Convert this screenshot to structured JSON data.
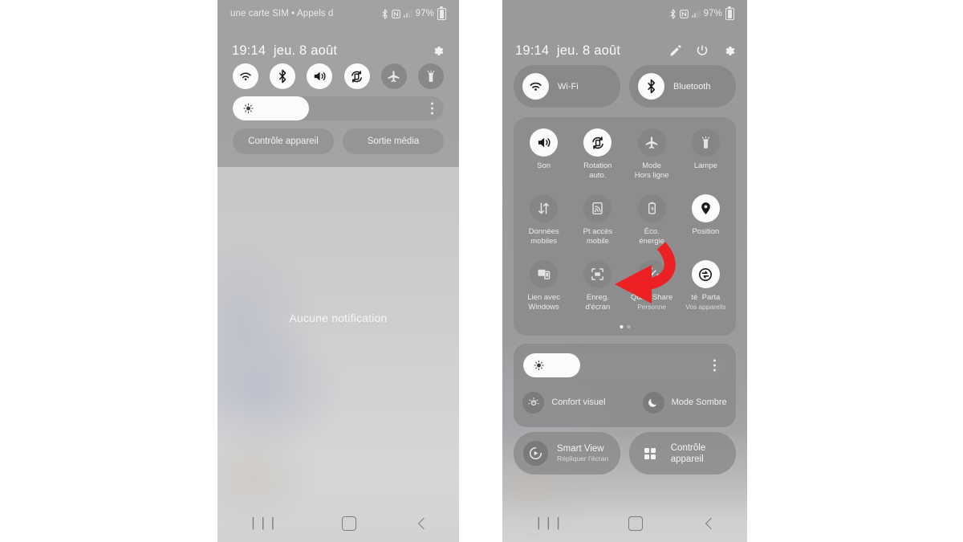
{
  "left_phone": {
    "status_bar": {
      "carrier_text": "une carte SIM • Appels d",
      "battery_percent": "97%",
      "icons": [
        "bluetooth-icon",
        "nfc-icon",
        "signal-icon",
        "battery-icon"
      ]
    },
    "clock": {
      "time": "19:14",
      "date": "jeu. 8 août"
    },
    "header_actions": [
      {
        "name": "settings-gear-button",
        "icon": "gear-icon"
      }
    ],
    "toggles": [
      {
        "name": "wifi",
        "icon": "wifi-icon",
        "state": "on"
      },
      {
        "name": "bluetooth",
        "icon": "bluetooth-icon",
        "state": "on"
      },
      {
        "name": "sound",
        "icon": "volume-icon",
        "state": "on"
      },
      {
        "name": "auto-rotate",
        "icon": "rotation-icon",
        "state": "on"
      },
      {
        "name": "airplane-mode",
        "icon": "airplane-icon",
        "state": "off"
      },
      {
        "name": "flashlight",
        "icon": "flashlight-icon",
        "state": "off"
      }
    ],
    "brightness": {
      "icon": "brightness-icon",
      "value_percent": 36,
      "menu_icon": "more-vertical-icon"
    },
    "wide_buttons": [
      {
        "name": "device-control",
        "label": "Contrôle appareil"
      },
      {
        "name": "media-output",
        "label": "Sortie média"
      }
    ],
    "notifications_empty_text": "Aucune notification",
    "nav_bar": [
      {
        "name": "recents",
        "icon": "recents-icon"
      },
      {
        "name": "home",
        "icon": "home-icon"
      },
      {
        "name": "back",
        "icon": "back-icon"
      }
    ]
  },
  "right_phone": {
    "status_bar": {
      "carrier_text": "",
      "battery_percent": "97%",
      "icons": [
        "bluetooth-icon",
        "nfc-icon",
        "signal-icon",
        "battery-icon"
      ]
    },
    "clock": {
      "time": "19:14",
      "date": "jeu. 8 août"
    },
    "header_actions": [
      {
        "name": "edit-button",
        "icon": "pencil-icon"
      },
      {
        "name": "power-button",
        "icon": "power-icon"
      },
      {
        "name": "settings-gear-button",
        "icon": "gear-icon"
      }
    ],
    "top_pills": [
      {
        "name": "wifi-pill",
        "label": "Wi-Fi",
        "icon": "wifi-icon",
        "state": "on"
      },
      {
        "name": "bluetooth-pill",
        "label": "Bluetooth",
        "icon": "bluetooth-icon",
        "state": "on"
      }
    ],
    "quick_tiles": [
      {
        "name": "sound",
        "label": "Son",
        "sub": "",
        "icon": "volume-icon",
        "state": "on"
      },
      {
        "name": "auto-rotate",
        "label": "Rotation\nauto.",
        "sub": "",
        "icon": "rotation-icon",
        "state": "on"
      },
      {
        "name": "airplane-mode",
        "label": "Mode\nHors ligne",
        "sub": "",
        "icon": "airplane-icon",
        "state": "off"
      },
      {
        "name": "flashlight",
        "label": "Lampe",
        "sub": "",
        "icon": "flashlight-icon",
        "state": "off"
      },
      {
        "name": "mobile-data",
        "label": "Données\nmobiles",
        "sub": "",
        "icon": "data-transfer-icon",
        "state": "off"
      },
      {
        "name": "mobile-hotspot",
        "label": "Pt accès\nmobile",
        "sub": "",
        "icon": "hotspot-icon",
        "state": "off"
      },
      {
        "name": "power-saving",
        "label": "Éco.\nénergie",
        "sub": "",
        "icon": "battery-saver-icon",
        "state": "off"
      },
      {
        "name": "location",
        "label": "Position",
        "sub": "",
        "icon": "location-pin-icon",
        "state": "on"
      },
      {
        "name": "link-to-windows",
        "label": "Lien avec\nWindows",
        "sub": "",
        "icon": "devices-icon",
        "state": "off"
      },
      {
        "name": "screen-recorder",
        "label": "Enreg.\nd'écran",
        "sub": "",
        "icon": "screen-record-icon",
        "state": "off"
      },
      {
        "name": "quick-share",
        "label": "Quick Share",
        "sub": "Personne",
        "icon": "quick-share-icon",
        "state": "off"
      },
      {
        "name": "nearby-share",
        "label": "Parta",
        "label_prefix": "té",
        "sub": "Vos appareils",
        "icon": "nearby-share-icon",
        "state": "on"
      }
    ],
    "page_dots": {
      "count": 2,
      "active_index": 0
    },
    "brightness": {
      "icon": "brightness-icon",
      "value_percent": 28,
      "menu_icon": "more-vertical-icon"
    },
    "mode_row": [
      {
        "name": "eye-comfort-shield",
        "label": "Confort visuel",
        "icon": "eye-comfort-icon"
      },
      {
        "name": "dark-mode",
        "label": "Mode Sombre",
        "icon": "moon-icon"
      }
    ],
    "bottom_pills": [
      {
        "name": "smart-view",
        "title": "Smart View",
        "subtitle": "Répliquer l'écran",
        "icon": "smart-view-icon"
      },
      {
        "name": "device-control",
        "title": "Contrôle appareil",
        "subtitle": "",
        "icon": "grid-squares-icon"
      }
    ],
    "nav_bar": [
      {
        "name": "recents",
        "icon": "recents-icon"
      },
      {
        "name": "home",
        "icon": "home-icon"
      },
      {
        "name": "back",
        "icon": "back-icon"
      }
    ]
  },
  "annotation": {
    "name": "red-curved-arrow",
    "color": "#ED2024",
    "points_to": "screen-recorder",
    "description": "curved red arrow pointing left at the screen recorder tile"
  },
  "colors": {
    "annotation_red": "#ED2024",
    "panel_bg": "#8a8a8a",
    "tile_on": "#fbfbfb",
    "tile_off": "#848484",
    "text_primary": "#f2f2f2",
    "page_bg": "#ffffff"
  }
}
